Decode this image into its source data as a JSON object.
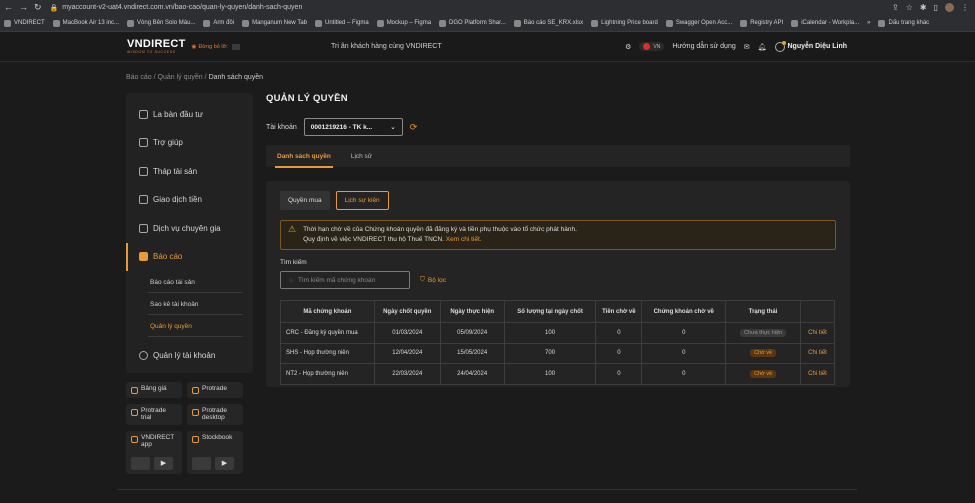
{
  "browser": {
    "url": "myaccount-v2-uat4.vndirect.com.vn/bao-cao/quan-ly-quyen/danh-sach-quyen",
    "bookmarks": [
      "VNDIRECT",
      "MacBook Air 13 inc...",
      "Vòng Bên Solo Màu...",
      "Arm đôi",
      "Manganum New Tab",
      "Untitled – Figma",
      "Mockup – Figma",
      "DGO Platform Shar...",
      "Báo cáo SE_KRX.xlsx",
      "Lightning Price board",
      "Swagger Open Acc...",
      "Registry API",
      "iCalendar - Workpla..."
    ],
    "bookmarks_more": "»",
    "bookmarks_folder": "Dấu trang khác"
  },
  "header": {
    "logo": "VNDIRECT",
    "tagline": "WISDOM TO SUCCESS",
    "dung_bo_lo": "Đừng bỏ lỡ:",
    "promo": "Tri ân khách hàng cùng VNDIRECT",
    "lang": "VN",
    "guide": "Hướng dẫn sử dụng",
    "user": "Nguyễn Diệu Linh"
  },
  "breadcrumb": {
    "items": [
      "Báo cáo",
      "Quản lý quyền"
    ],
    "current": "Danh sách quyền",
    "separator": "/"
  },
  "sidebar": {
    "items": [
      {
        "label": "La bàn đầu tư"
      },
      {
        "label": "Trợ giúp"
      },
      {
        "label": "Tháp tài sản"
      },
      {
        "label": "Giao dịch tiền"
      },
      {
        "label": "Dịch vụ chuyên gia"
      },
      {
        "label": "Báo cáo"
      }
    ],
    "sub_items": [
      "Báo cáo tài sản",
      "Sao kê tài khoản",
      "Quản lý quyền"
    ],
    "account_mgmt": "Quản lý tài khoản"
  },
  "apps": {
    "bang_gia": "Bảng giá",
    "protrade": "Protrade",
    "protrade_trial": [
      "Protrade",
      "trial"
    ],
    "protrade_desktop": [
      "Protrade",
      "desktop"
    ],
    "vndirect_app": [
      "VNDIRECT",
      "app"
    ],
    "stockbook": "Stockbook"
  },
  "main": {
    "title": "QUẢN LÝ QUYỀN",
    "account_label": "Tài khoản",
    "account_value": "0001219216 - TK k...",
    "tabs": [
      "Danh sách quyền",
      "Lịch sử"
    ],
    "buttons": [
      "Quyền mua",
      "Lịch sự kiện"
    ],
    "notice_line1": "Thời hạn chờ về của Chứng khoán quyền đã đăng ký và tiền phụ thuộc vào tổ chức phát hành.",
    "notice_line2": "Quy định về việc VNDIRECT thu hộ Thuế TNCN.",
    "notice_link": "Xem chi tiết.",
    "search_label": "Tìm kiếm",
    "search_placeholder": "Tìm kiếm mã chứng khoán",
    "filter": "Bộ lọc"
  },
  "table": {
    "headers": [
      "Mã chứng khoán",
      "Ngày chốt quyền",
      "Ngày thực hiện",
      "Số lượng tại ngày chốt",
      "Tiền chờ về",
      "Chứng khoán chờ về",
      "Trạng thái",
      ""
    ],
    "rows": [
      {
        "code": "CRC - Đăng ký quyền mua",
        "record_date": "01/03/2024",
        "exec_date": "05/09/2024",
        "qty": "100",
        "cash": "0",
        "stock": "0",
        "status": "Chưa thực hiện",
        "status_style": "grey",
        "action": "Chi tiết"
      },
      {
        "code": "SHS - Họp thường niên",
        "record_date": "12/04/2024",
        "exec_date": "15/05/2024",
        "qty": "700",
        "cash": "0",
        "stock": "0",
        "status": "Chờ về",
        "status_style": "orange",
        "action": "Chi tiết"
      },
      {
        "code": "NT2 - Họp thường niên",
        "record_date": "22/03/2024",
        "exec_date": "24/04/2024",
        "qty": "100",
        "cash": "0",
        "stock": "0",
        "status": "Chờ về",
        "status_style": "orange",
        "action": "Chi tiết"
      }
    ]
  },
  "colors": {
    "accent": "#e89a3a",
    "background": "#1b1b1b",
    "panel": "#242424"
  }
}
